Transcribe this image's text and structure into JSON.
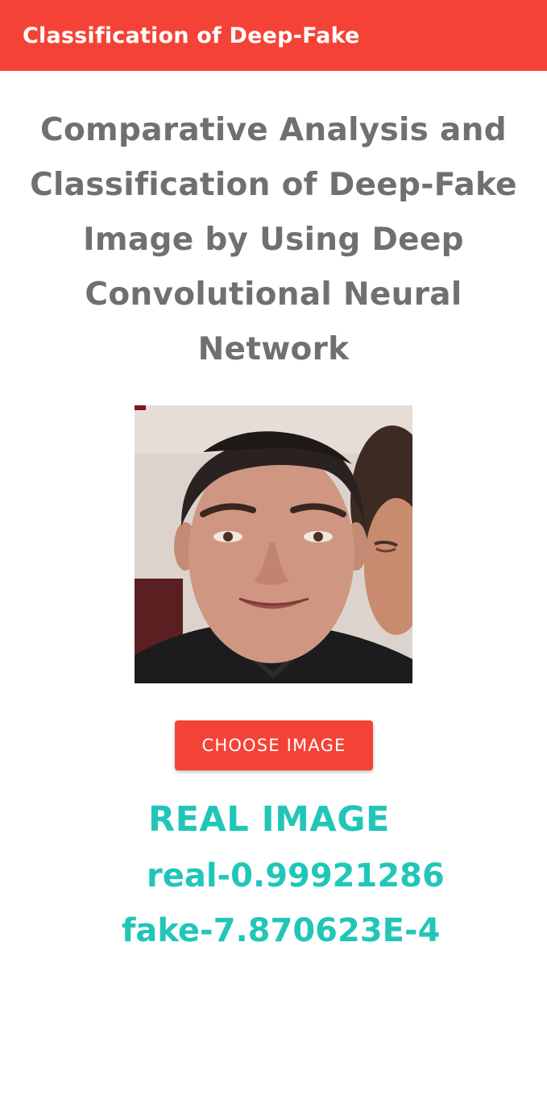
{
  "app_bar": {
    "title": "Classification of Deep-Fake",
    "color": "#f44336"
  },
  "main": {
    "heading": "Comparative Analysis and Classification of Deep-Fake Image by Using Deep Convolutional Neural Network",
    "choose_button_label": "CHOOSE IMAGE",
    "result": {
      "label": "REAL IMAGE",
      "real_score": "real-0.99921286",
      "fake_score": "fake-7.870623E-4",
      "color": "#21c6b8"
    }
  }
}
